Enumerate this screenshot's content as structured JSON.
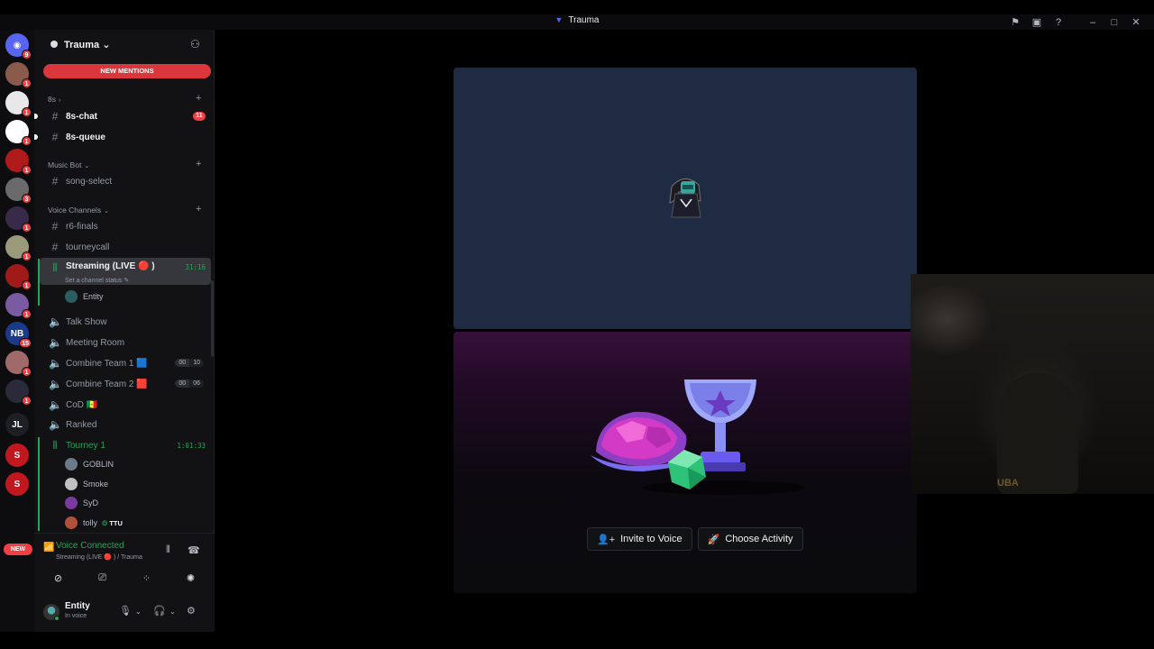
{
  "window": {
    "title": "Trauma"
  },
  "rail": {
    "servers": [
      {
        "name": "discord-home",
        "badge": "9",
        "color": "#5865f2",
        "label": "◉"
      },
      {
        "name": "server-1",
        "badge": "1",
        "color": "#8a5a4a",
        "label": ""
      },
      {
        "name": "server-2",
        "badge": "1",
        "color": "#e8e8e8",
        "label": ""
      },
      {
        "name": "server-3",
        "badge": "1",
        "color": "#ffffff",
        "label": ""
      },
      {
        "name": "server-4",
        "badge": "1",
        "color": "#b01a1a",
        "label": ""
      },
      {
        "name": "server-5",
        "badge": "3",
        "color": "#6a6a6a",
        "label": ""
      },
      {
        "name": "server-6",
        "badge": "1",
        "color": "#3a2a4a",
        "label": ""
      },
      {
        "name": "server-7",
        "badge": "1",
        "color": "#9a9a7a",
        "label": ""
      },
      {
        "name": "server-8",
        "badge": "1",
        "color": "#a01a1a",
        "label": ""
      },
      {
        "name": "server-9",
        "badge": "1",
        "color": "#7a5aa0",
        "label": ""
      },
      {
        "name": "server-10",
        "badge": "15",
        "color": "#1a3a8a",
        "label": "NB"
      },
      {
        "name": "server-11",
        "badge": "1",
        "color": "#a06a6a",
        "label": ""
      },
      {
        "name": "server-12",
        "badge": "1",
        "color": "#2a2a3a",
        "label": ""
      },
      {
        "name": "server-jl",
        "badge": "",
        "color": "#1e1f22",
        "label": "JL"
      },
      {
        "name": "server-13",
        "badge": "",
        "color": "#c0181e",
        "label": "S"
      },
      {
        "name": "server-14",
        "badge": "",
        "color": "#c0181e",
        "label": "S"
      }
    ],
    "new_label": "NEW"
  },
  "guild": {
    "name": "Trauma",
    "new_mentions": "NEW MENTIONS",
    "categories": {
      "eights": "8s",
      "music": "Music Bot",
      "voice": "Voice Channels"
    },
    "text_channels": {
      "chat": {
        "name": "8s-chat",
        "mentions": "11"
      },
      "queue": {
        "name": "8s-queue"
      },
      "song": {
        "name": "song-select"
      },
      "r6": {
        "name": "r6-finals"
      },
      "tourneycall": {
        "name": "tourneycall"
      }
    },
    "voice_channels": {
      "streaming": {
        "name": "Streaming (LIVE 🔴 )",
        "timer": "31:16",
        "status": "Set a channel status"
      },
      "talk": {
        "name": "Talk Show"
      },
      "meeting": {
        "name": "Meeting Room"
      },
      "combine1": {
        "name": "Combine Team 1 🟦",
        "count_a": "00",
        "count_b": "10"
      },
      "combine2": {
        "name": "Combine Team 2 🟥",
        "count_a": "00",
        "count_b": "06"
      },
      "cod": {
        "name": "CoD 🇸🇳"
      },
      "ranked": {
        "name": "Ranked"
      },
      "tourney": {
        "name": "Tourney 1",
        "timer": "1:01:33"
      }
    },
    "streaming_users": [
      "Entity"
    ],
    "tourney_users": [
      {
        "name": "GOBLIN",
        "tag": ""
      },
      {
        "name": "Smoke",
        "tag": ""
      },
      {
        "name": "SyD",
        "tag": ""
      },
      {
        "name": "tolly",
        "tag": "TTU"
      }
    ]
  },
  "voice_panel": {
    "title": "Voice Connected",
    "subtitle": "Streaming (LIVE 🔴 ) / Trauma"
  },
  "user": {
    "name": "Entity",
    "status": "In voice"
  },
  "activity": {
    "invite_label": "Invite to Voice",
    "choose_label": "Choose Activity"
  },
  "webcam": {
    "shirt_text": "UBA"
  },
  "colors": {
    "accent": "#5865f2",
    "online": "#23a55a",
    "danger": "#f23f43"
  }
}
